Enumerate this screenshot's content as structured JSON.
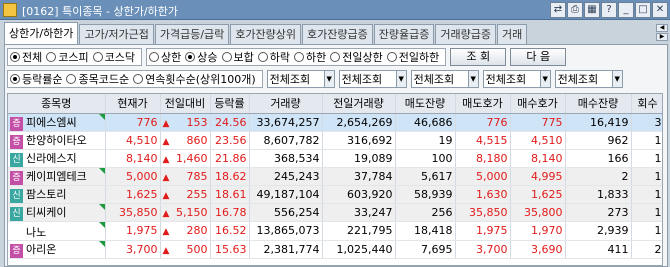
{
  "window": {
    "title": "[0162] 특이종목 - 상한가/하한가",
    "buttons": [
      {
        "name": "link-icon",
        "glyph": "⇄"
      },
      {
        "name": "print-icon",
        "glyph": "⎙"
      },
      {
        "name": "chart-icon",
        "glyph": "▦"
      },
      {
        "name": "help-icon",
        "glyph": "?"
      },
      {
        "name": "minimize-icon",
        "glyph": "_"
      },
      {
        "name": "maximize-icon",
        "glyph": "□"
      },
      {
        "name": "close-icon",
        "glyph": "✕"
      }
    ]
  },
  "tabs": [
    {
      "label": "상한가/하한가",
      "active": true
    },
    {
      "label": "고가/저가근접",
      "active": false
    },
    {
      "label": "가격급등/급락",
      "active": false
    },
    {
      "label": "호가잔량상위",
      "active": false
    },
    {
      "label": "호가잔량급증",
      "active": false
    },
    {
      "label": "잔량율급증",
      "active": false
    },
    {
      "label": "거래량급증",
      "active": false
    },
    {
      "label": "거래",
      "active": false
    }
  ],
  "filters": {
    "market": [
      {
        "label": "전체",
        "on": true
      },
      {
        "label": "코스피",
        "on": false
      },
      {
        "label": "코스닥",
        "on": false
      }
    ],
    "type": [
      {
        "label": "상한",
        "on": false
      },
      {
        "label": "상승",
        "on": true
      },
      {
        "label": "보합",
        "on": false
      },
      {
        "label": "하락",
        "on": false
      },
      {
        "label": "하한",
        "on": false
      },
      {
        "label": "전일상한",
        "on": false
      },
      {
        "label": "전일하한",
        "on": false
      }
    ],
    "query_label": "조 회",
    "next_label": "다 음",
    "sort": [
      {
        "label": "등락률순",
        "on": true
      },
      {
        "label": "종목코드순",
        "on": false
      },
      {
        "label": "연속횟수순(상위100개)",
        "on": false
      }
    ],
    "selects": [
      "전체조회",
      "전체조회",
      "전체조회",
      "전체조회",
      "전체조회"
    ]
  },
  "colors": {
    "up": "#e21b1b",
    "down": "#1243c9",
    "badge_jeung": "#c44fa7",
    "badge_sin": "#3aa8a0",
    "badge_gong": "#d08a1e"
  },
  "table": {
    "headers": [
      "종목명",
      "현재가",
      "전일대비",
      "등락률",
      "거래량",
      "전일거래량",
      "매도잔량",
      "매도호가",
      "매수호가",
      "매수잔량",
      "회수"
    ],
    "rows": [
      {
        "badge": "증",
        "badge_color": "#c44fa7",
        "name": "피에스엠씨",
        "flag": true,
        "price": "776",
        "change": "153",
        "rate": "24.56",
        "volume": "33,674,257",
        "prev_volume": "2,654,269",
        "ask_qty": "46,686",
        "ask": "776",
        "bid": "775",
        "bid_qty": "16,419",
        "count": "3",
        "style": "sel"
      },
      {
        "badge": "증",
        "badge_color": "#c44fa7",
        "name": "한양하이타오",
        "flag": false,
        "price": "4,510",
        "change": "860",
        "rate": "23.56",
        "volume": "8,607,782",
        "prev_volume": "316,692",
        "ask_qty": "19",
        "ask": "4,515",
        "bid": "4,510",
        "bid_qty": "962",
        "count": "1",
        "style": ""
      },
      {
        "badge": "신",
        "badge_color": "#3aa8a0",
        "name": "신라에스지",
        "flag": false,
        "price": "8,140",
        "change": "1,460",
        "rate": "21.86",
        "volume": "368,534",
        "prev_volume": "19,089",
        "ask_qty": "100",
        "ask": "8,180",
        "bid": "8,140",
        "bid_qty": "166",
        "count": "1",
        "style": ""
      },
      {
        "badge": "증",
        "badge_color": "#c44fa7",
        "name": "케이피엠테크",
        "flag": true,
        "price": "5,000",
        "change": "785",
        "rate": "18.62",
        "volume": "245,243",
        "prev_volume": "37,784",
        "ask_qty": "5,617",
        "ask": "5,000",
        "bid": "4,995",
        "bid_qty": "2",
        "count": "1",
        "style": "gray"
      },
      {
        "badge": "신",
        "badge_color": "#3aa8a0",
        "name": "팜스토리",
        "flag": false,
        "price": "1,625",
        "change": "255",
        "rate": "18.61",
        "volume": "49,187,104",
        "prev_volume": "603,920",
        "ask_qty": "58,939",
        "ask": "1,630",
        "bid": "1,625",
        "bid_qty": "1,833",
        "count": "1",
        "style": "gray"
      },
      {
        "badge": "신",
        "badge_color": "#3aa8a0",
        "name": "티씨케이",
        "flag": true,
        "price": "35,850",
        "change": "5,150",
        "rate": "16.78",
        "volume": "556,254",
        "prev_volume": "33,247",
        "ask_qty": "256",
        "ask": "35,850",
        "bid": "35,800",
        "bid_qty": "273",
        "count": "1",
        "style": "gray"
      },
      {
        "badge": "",
        "badge_color": "",
        "name": "나노",
        "flag": true,
        "price": "1,975",
        "change": "280",
        "rate": "16.52",
        "volume": "13,865,073",
        "prev_volume": "221,795",
        "ask_qty": "18,418",
        "ask": "1,975",
        "bid": "1,970",
        "bid_qty": "2,939",
        "count": "1",
        "style": ""
      },
      {
        "badge": "증",
        "badge_color": "#c44fa7",
        "name": "아리온",
        "flag": true,
        "price": "3,700",
        "change": "500",
        "rate": "15.63",
        "volume": "2,381,774",
        "prev_volume": "1,025,440",
        "ask_qty": "7,695",
        "ask": "3,700",
        "bid": "3,690",
        "bid_qty": "411",
        "count": "2",
        "style": ""
      }
    ]
  }
}
